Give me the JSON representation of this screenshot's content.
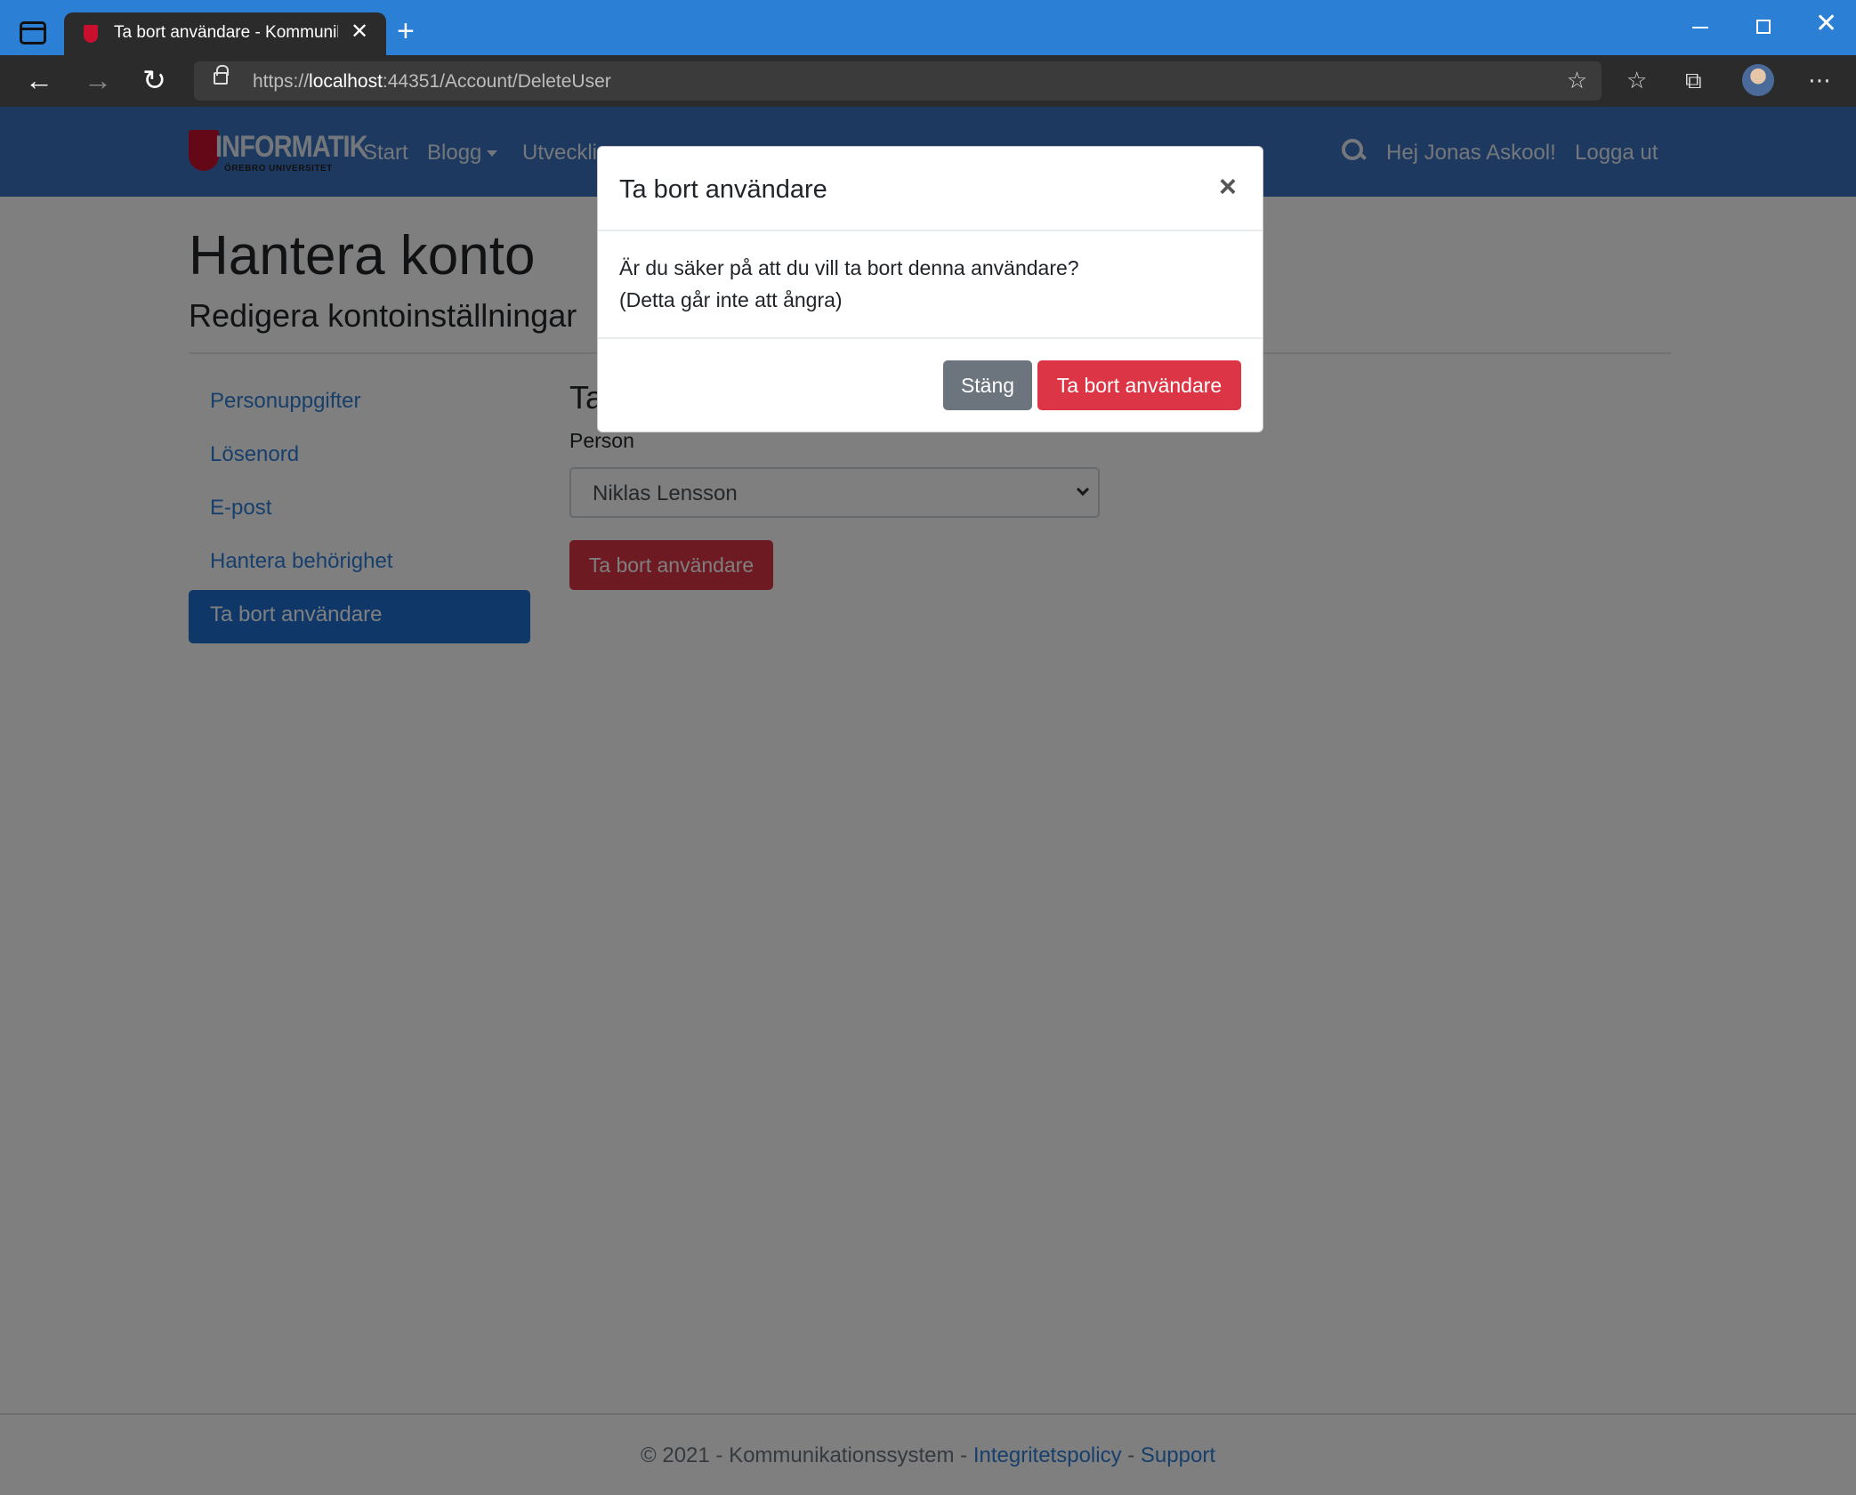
{
  "browser": {
    "tab_title": "Ta bort användare - Kommunikat",
    "url_prefix": "https://",
    "url_host": "localhost",
    "url_rest": ":44351/Account/DeleteUser"
  },
  "site": {
    "logo_text": "INFORMATIK",
    "logo_subtext": "ÖREBRO UNIVERSITET",
    "nav": {
      "start": "Start",
      "blogg": "Blogg",
      "utveckling": "Utveckli"
    },
    "greeting": "Hej Jonas Askool!",
    "logout": "Logga ut"
  },
  "page": {
    "title": "Hantera konto",
    "subtitle": "Redigera kontoinställningar",
    "content_title": "Ta",
    "sidebar": [
      {
        "label": "Personuppgifter"
      },
      {
        "label": "Lösenord"
      },
      {
        "label": "E-post"
      },
      {
        "label": "Hantera behörighet"
      },
      {
        "label": "Ta bort användare"
      }
    ],
    "person_label": "Person",
    "person_selected": "Niklas Lensson",
    "delete_button": "Ta bort användare"
  },
  "footer": {
    "text": "© 2021 - Kommunikationssystem -",
    "privacy": "Integritetspolicy",
    "separator": "-",
    "support": "Support"
  },
  "modal": {
    "title": "Ta bort användare",
    "close_symbol": "×",
    "line1": "Är du säker på att du vill ta bort denna användare?",
    "line2": "(Detta går inte att ångra)",
    "cancel_label": "Stäng",
    "confirm_label": "Ta bort användare"
  }
}
